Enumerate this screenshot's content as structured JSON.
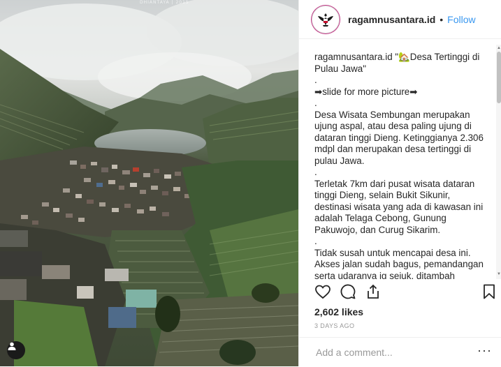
{
  "post": {
    "username": "ragamnusantara.id",
    "dot": "•",
    "follow_label": "Follow",
    "watermark": "DHIANTAYA | 2015"
  },
  "caption": {
    "author": "ragamnusantara.id",
    "line1": " \"🏡Desa Tertinggi di Pulau Jawa\"",
    "dot1": ".",
    "slide": "➡slide for more picture➡",
    "dot2": ".",
    "para1": "Desa Wisata Sembungan merupakan ujung aspal, atau desa paling ujung di dataran tinggi Dieng. Ketinggianya 2.306 mdpl dan merupakan desa tertinggi di pulau Jawa.",
    "dot3": ".",
    "para2": "Terletak 7km dari pusat wisata dataran tinggi Dieng, selain Bukit Sikunir, destinasi wisata yang ada di kawasan ini adalah Telaga Cebong, Gunung Pakuwojo, dan Curug Sikarim.",
    "dot4": ".",
    "para3": "Tidak susah untuk mencapai desa ini. Akses jalan sudah bagus, pemandangan serta udaranya jg sejuk, ditambah"
  },
  "stats": {
    "likes": "2,602 likes",
    "time_ago": "3 DAYS AGO"
  },
  "comment": {
    "placeholder": "Add a comment...",
    "more": "···"
  },
  "icons": {
    "like": "heart-icon",
    "comment": "comment-icon",
    "share": "share-icon",
    "save": "bookmark-icon",
    "user_tag": "user-tag-icon",
    "avatar": "garuda-emblem"
  },
  "colors": {
    "follow": "#3897f0",
    "text": "#262626",
    "muted": "#999999",
    "border": "#efefef"
  }
}
